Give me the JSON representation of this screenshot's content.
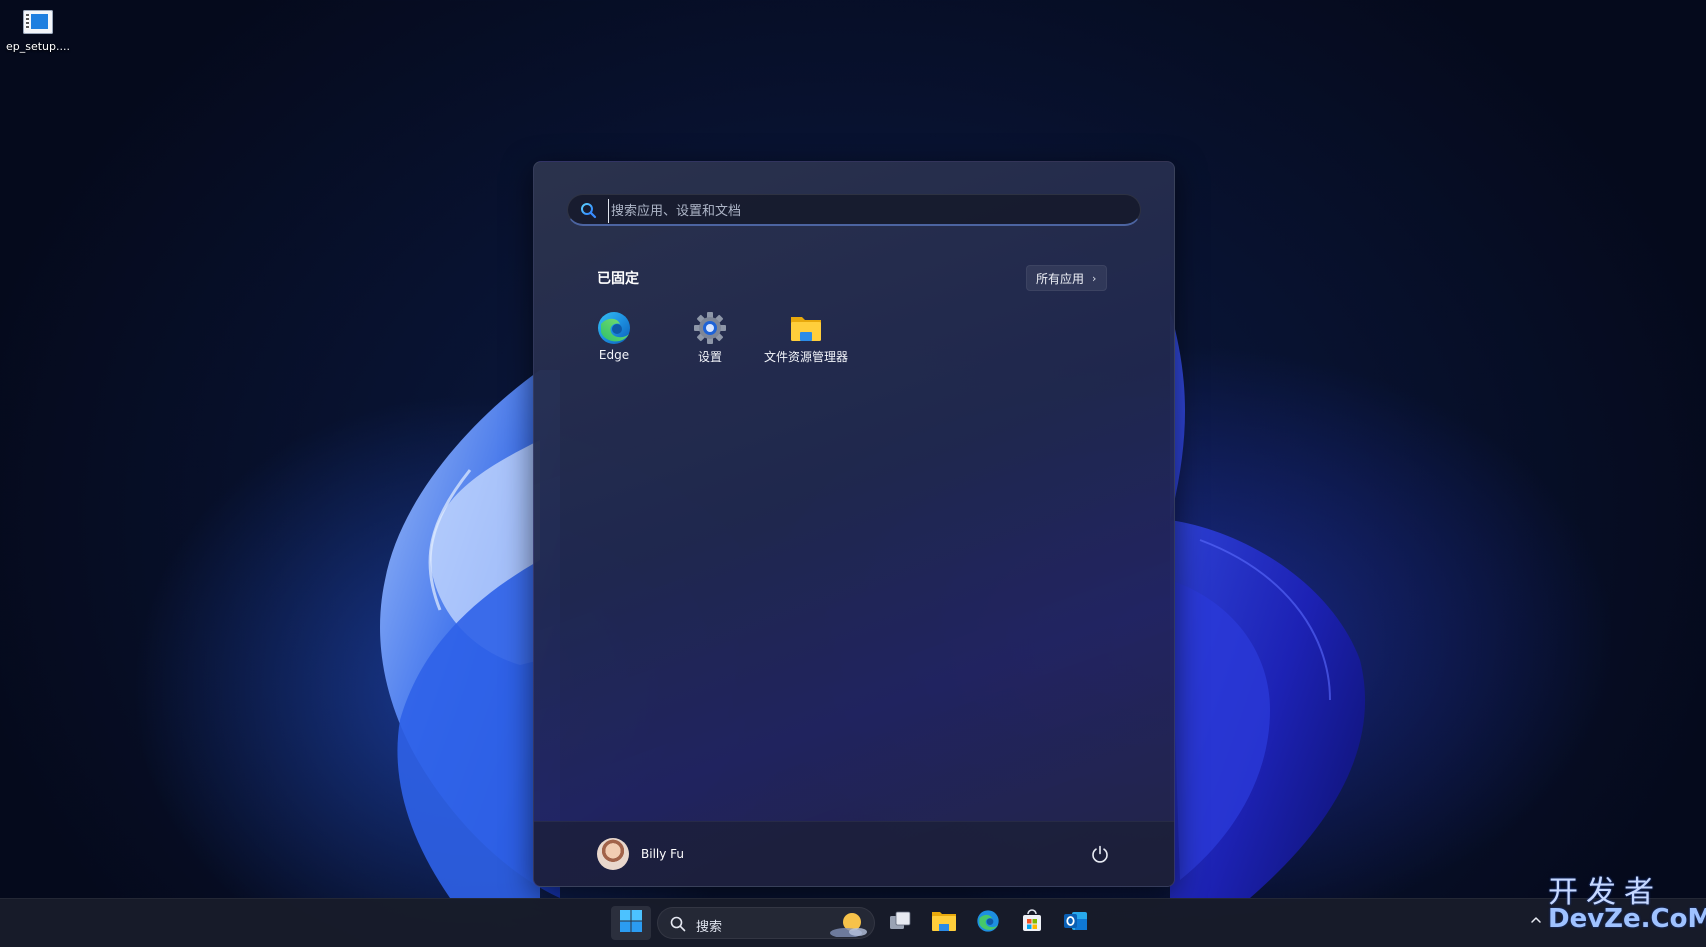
{
  "desktop": {
    "icons": [
      {
        "label": "ep_setup....",
        "icon": "installer-icon"
      }
    ]
  },
  "start_menu": {
    "search": {
      "placeholder": "搜索应用、设置和文档",
      "icon": "search-icon"
    },
    "pinned": {
      "title": "已固定",
      "all_apps_label": "所有应用",
      "apps": [
        {
          "name": "Edge",
          "icon": "edge-icon"
        },
        {
          "name": "设置",
          "icon": "settings-gear-icon"
        },
        {
          "name": "文件资源管理器",
          "icon": "folder-icon"
        }
      ]
    },
    "user": {
      "name": "Billy Fu",
      "icon": "avatar"
    },
    "power_icon": "power-icon"
  },
  "taskbar": {
    "search_label": "搜索",
    "items": [
      "windows-start-icon",
      "task-view-icon",
      "file-explorer-icon",
      "edge-icon",
      "store-icon",
      "outlook-icon"
    ],
    "tray": {
      "overflow_icon": "chevron-up-icon"
    }
  },
  "watermark": {
    "cn": "开发者",
    "en": "DevZe.CoM"
  },
  "colors": {
    "accent": "#4c8dff",
    "taskbar": "#181c2a",
    "start_bg": "#2a3150"
  }
}
